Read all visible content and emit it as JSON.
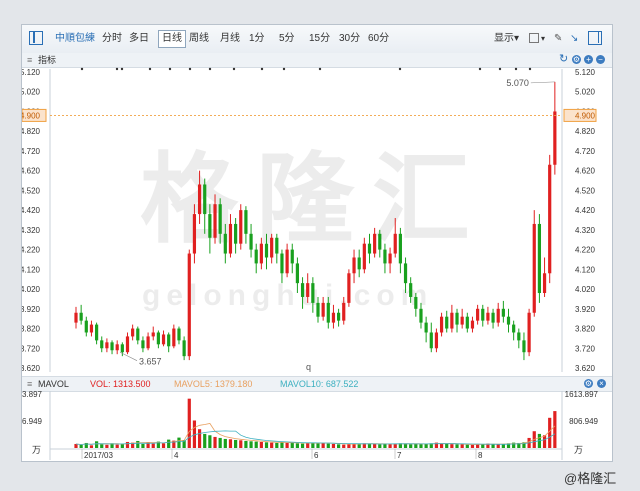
{
  "toolbar": {
    "stock_name": "中順包練",
    "buttons": [
      {
        "label": "分时"
      },
      {
        "label": "多日"
      },
      {
        "label": "日线"
      },
      {
        "label": "周线"
      },
      {
        "label": "月线"
      },
      {
        "label": "1分"
      },
      {
        "label": "5分"
      },
      {
        "label": "15分"
      },
      {
        "label": "30分"
      },
      {
        "label": "60分"
      }
    ],
    "active_index": 2,
    "display_label": "显示▾"
  },
  "indicator_bar": {
    "label": "指标"
  },
  "sub_bar": {
    "name": "MAVOL",
    "vol_label": "VOL: 1313.500",
    "ma5_label": "MAVOL5: 1379.180",
    "ma10_label": "MAVOL10: 687.522"
  },
  "watermark": {
    "text": "格隆汇",
    "url": "gelonghui.com"
  },
  "brand": "@格隆汇",
  "colors": {
    "up": "#e02020",
    "down": "#19a01e",
    "ma5": "#e8a060",
    "ma10": "#3cb0c0",
    "price_line": "#f0a040"
  },
  "chart_data": {
    "type": "candlestick",
    "price_axis": {
      "ticks": [
        "5.120",
        "5.020",
        "4.920",
        "4.820",
        "4.720",
        "4.620",
        "4.520",
        "4.420",
        "4.320",
        "4.220",
        "4.120",
        "4.020",
        "3.920",
        "3.820",
        "3.720",
        "3.620"
      ],
      "ylim": [
        3.62,
        5.12
      ]
    },
    "current_price": "4.900",
    "annotations": {
      "high": "5.070",
      "low": "3.657",
      "misc": "q"
    },
    "x_labels": [
      "2017/03",
      "4",
      "6",
      "7",
      "8"
    ],
    "volume_axis": {
      "ticks": [
        "1613.897",
        "806.949"
      ],
      "unit": "万"
    },
    "candles": [
      [
        3.85,
        3.9,
        3.82,
        3.93
      ],
      [
        3.9,
        3.86,
        3.84,
        3.94
      ],
      [
        3.86,
        3.8,
        3.78,
        3.88
      ],
      [
        3.8,
        3.84,
        3.78,
        3.86
      ],
      [
        3.84,
        3.76,
        3.74,
        3.85
      ],
      [
        3.76,
        3.72,
        3.7,
        3.78
      ],
      [
        3.72,
        3.75,
        3.7,
        3.77
      ],
      [
        3.75,
        3.71,
        3.69,
        3.76
      ],
      [
        3.71,
        3.74,
        3.69,
        3.76
      ],
      [
        3.74,
        3.7,
        3.68,
        3.75
      ],
      [
        3.7,
        3.78,
        3.69,
        3.8
      ],
      [
        3.78,
        3.82,
        3.76,
        3.84
      ],
      [
        3.82,
        3.76,
        3.74,
        3.83
      ],
      [
        3.76,
        3.72,
        3.7,
        3.78
      ],
      [
        3.72,
        3.78,
        3.71,
        3.8
      ],
      [
        3.78,
        3.8,
        3.76,
        3.83
      ],
      [
        3.8,
        3.74,
        3.72,
        3.81
      ],
      [
        3.74,
        3.79,
        3.73,
        3.81
      ],
      [
        3.79,
        3.73,
        3.7,
        3.8
      ],
      [
        3.73,
        3.82,
        3.72,
        3.84
      ],
      [
        3.82,
        3.76,
        3.74,
        3.83
      ],
      [
        3.76,
        3.68,
        3.66,
        3.78
      ],
      [
        3.68,
        4.2,
        3.66,
        4.22
      ],
      [
        4.2,
        4.4,
        4.15,
        4.45
      ],
      [
        4.4,
        4.55,
        4.35,
        4.62
      ],
      [
        4.55,
        4.4,
        4.3,
        4.58
      ],
      [
        4.4,
        4.28,
        4.2,
        4.45
      ],
      [
        4.28,
        4.45,
        4.25,
        4.5
      ],
      [
        4.45,
        4.3,
        4.25,
        4.48
      ],
      [
        4.3,
        4.2,
        4.15,
        4.35
      ],
      [
        4.2,
        4.35,
        4.18,
        4.4
      ],
      [
        4.35,
        4.25,
        4.2,
        4.38
      ],
      [
        4.25,
        4.42,
        4.22,
        4.45
      ],
      [
        4.42,
        4.3,
        4.25,
        4.44
      ],
      [
        4.3,
        4.22,
        4.18,
        4.35
      ],
      [
        4.22,
        4.15,
        4.1,
        4.25
      ],
      [
        4.15,
        4.25,
        4.12,
        4.28
      ],
      [
        4.25,
        4.18,
        4.12,
        4.3
      ],
      [
        4.18,
        4.28,
        4.15,
        4.3
      ],
      [
        4.28,
        4.2,
        4.15,
        4.3
      ],
      [
        4.2,
        4.1,
        4.05,
        4.22
      ],
      [
        4.1,
        4.22,
        4.08,
        4.25
      ],
      [
        4.22,
        4.15,
        4.1,
        4.25
      ],
      [
        4.15,
        4.05,
        4.0,
        4.18
      ],
      [
        4.05,
        3.98,
        3.92,
        4.08
      ],
      [
        3.98,
        4.05,
        3.95,
        4.1
      ],
      [
        4.05,
        3.95,
        3.9,
        4.08
      ],
      [
        3.95,
        3.88,
        3.85,
        3.98
      ],
      [
        3.88,
        3.95,
        3.86,
        3.98
      ],
      [
        3.95,
        3.85,
        3.82,
        3.98
      ],
      [
        3.85,
        3.9,
        3.82,
        3.94
      ],
      [
        3.9,
        3.86,
        3.83,
        3.92
      ],
      [
        3.86,
        3.95,
        3.84,
        3.98
      ],
      [
        3.95,
        4.1,
        3.93,
        4.12
      ],
      [
        4.1,
        4.18,
        4.05,
        4.22
      ],
      [
        4.18,
        4.12,
        4.08,
        4.22
      ],
      [
        4.12,
        4.25,
        4.1,
        4.28
      ],
      [
        4.25,
        4.2,
        4.15,
        4.3
      ],
      [
        4.2,
        4.3,
        4.18,
        4.33
      ],
      [
        4.3,
        4.22,
        4.18,
        4.32
      ],
      [
        4.22,
        4.15,
        4.1,
        4.25
      ],
      [
        4.15,
        4.2,
        4.1,
        4.23
      ],
      [
        4.2,
        4.3,
        4.18,
        4.38
      ],
      [
        4.3,
        4.15,
        4.1,
        4.33
      ],
      [
        4.15,
        4.05,
        4.0,
        4.18
      ],
      [
        4.05,
        3.98,
        3.95,
        4.08
      ],
      [
        3.98,
        3.92,
        3.88,
        4.0
      ],
      [
        3.92,
        3.85,
        3.82,
        3.95
      ],
      [
        3.85,
        3.8,
        3.75,
        3.88
      ],
      [
        3.8,
        3.72,
        3.7,
        3.85
      ],
      [
        3.72,
        3.8,
        3.7,
        3.82
      ],
      [
        3.8,
        3.88,
        3.78,
        3.9
      ],
      [
        3.88,
        3.82,
        3.8,
        3.91
      ],
      [
        3.82,
        3.9,
        3.8,
        3.94
      ],
      [
        3.9,
        3.84,
        3.8,
        3.92
      ],
      [
        3.84,
        3.88,
        3.82,
        3.92
      ],
      [
        3.88,
        3.82,
        3.8,
        3.9
      ],
      [
        3.82,
        3.86,
        3.8,
        3.88
      ],
      [
        3.86,
        3.92,
        3.84,
        3.94
      ],
      [
        3.92,
        3.86,
        3.83,
        3.94
      ],
      [
        3.86,
        3.9,
        3.84,
        3.93
      ],
      [
        3.9,
        3.85,
        3.82,
        3.92
      ],
      [
        3.85,
        3.92,
        3.83,
        3.95
      ],
      [
        3.92,
        3.88,
        3.85,
        3.96
      ],
      [
        3.88,
        3.84,
        3.8,
        3.92
      ],
      [
        3.84,
        3.8,
        3.76,
        3.86
      ],
      [
        3.8,
        3.76,
        3.72,
        3.82
      ],
      [
        3.76,
        3.7,
        3.66,
        3.8
      ],
      [
        3.7,
        3.9,
        3.68,
        3.92
      ],
      [
        3.9,
        4.35,
        3.88,
        4.42
      ],
      [
        4.35,
        4.0,
        3.95,
        4.4
      ],
      [
        4.0,
        4.1,
        3.98,
        4.18
      ],
      [
        4.1,
        4.65,
        4.05,
        4.7
      ],
      [
        4.65,
        4.92,
        4.6,
        5.07
      ]
    ],
    "volumes": [
      120,
      90,
      150,
      80,
      200,
      110,
      95,
      140,
      100,
      130,
      180,
      160,
      210,
      120,
      170,
      130,
      190,
      140,
      250,
      220,
      310,
      230,
      1470,
      820,
      560,
      420,
      380,
      330,
      300,
      270,
      260,
      240,
      230,
      210,
      200,
      190,
      180,
      170,
      160,
      150,
      170,
      160,
      150,
      140,
      130,
      150,
      160,
      140,
      150,
      130,
      120,
      110,
      100,
      120,
      130,
      125,
      140,
      130,
      120,
      110,
      120,
      115,
      130,
      140,
      135,
      110,
      120,
      115,
      125,
      140,
      160,
      130,
      120,
      115,
      110,
      105,
      100,
      95,
      110,
      120,
      130,
      115,
      105,
      120,
      140,
      160,
      150,
      170,
      300,
      500,
      420,
      380,
      900,
      1100
    ]
  }
}
